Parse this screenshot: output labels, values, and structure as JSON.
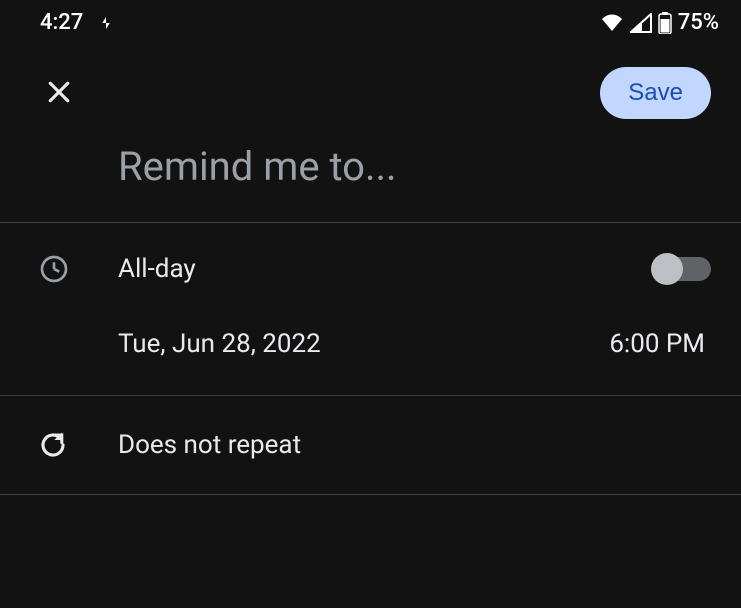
{
  "statusBar": {
    "time": "4:27",
    "batteryPercent": "75%"
  },
  "appBar": {
    "saveLabel": "Save"
  },
  "title": {
    "placeholder": "Remind me to...",
    "value": ""
  },
  "allDay": {
    "label": "All-day",
    "enabled": false
  },
  "dateTime": {
    "date": "Tue, Jun 28, 2022",
    "time": "6:00 PM"
  },
  "repeat": {
    "label": "Does not repeat"
  }
}
